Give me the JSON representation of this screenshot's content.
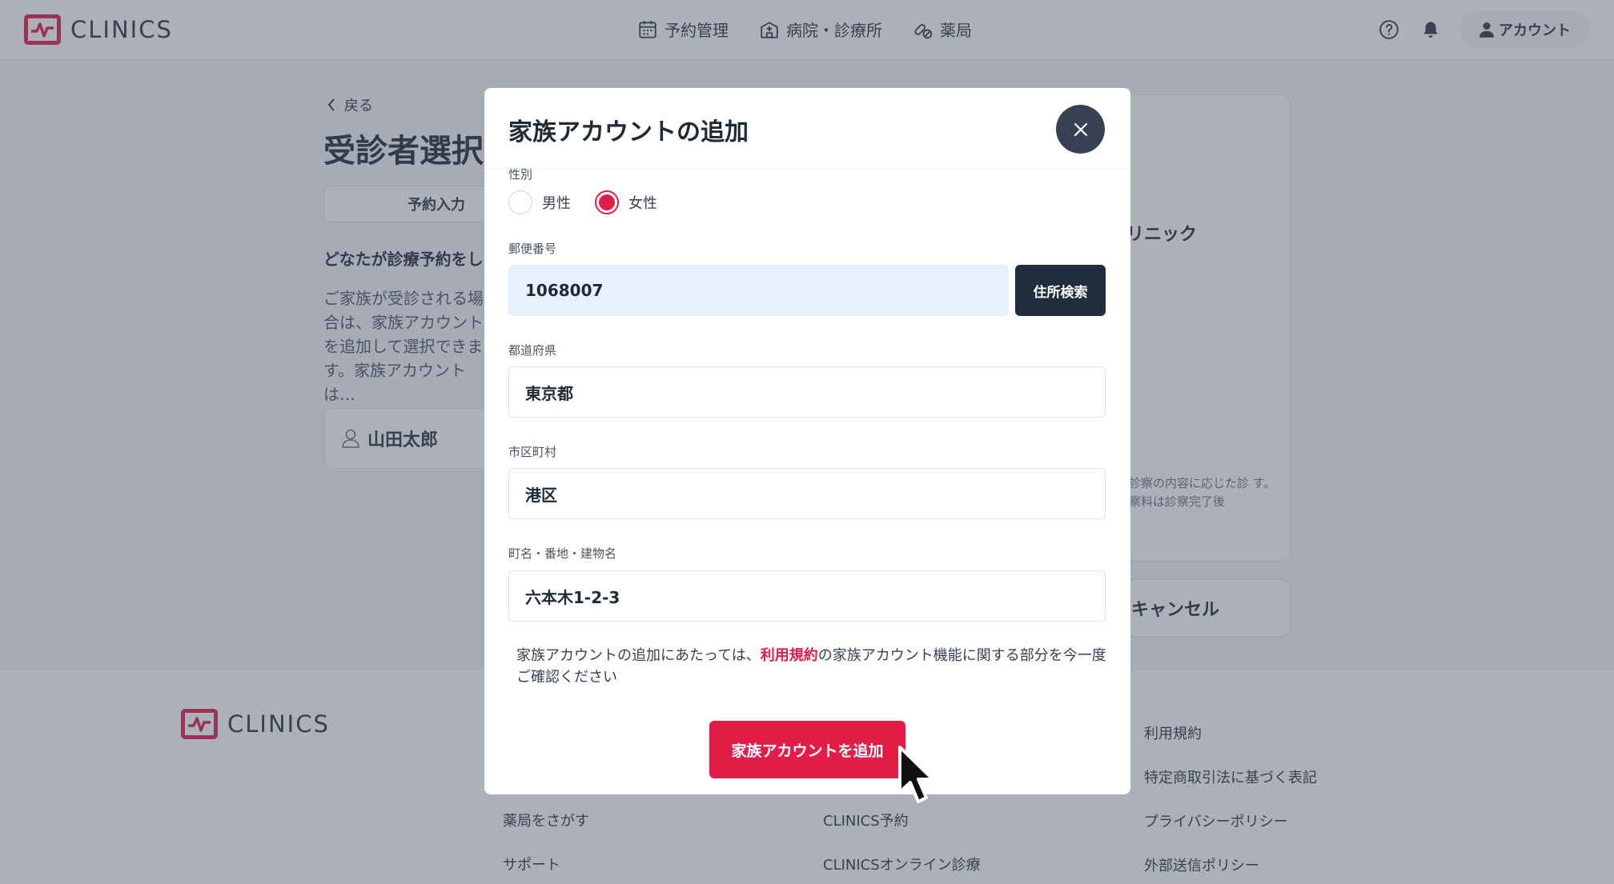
{
  "header": {
    "logo_text": "CLINICS",
    "nav": [
      {
        "label": "予約管理",
        "icon": "calendar-icon"
      },
      {
        "label": "病院・診療所",
        "icon": "hospital-icon"
      },
      {
        "label": "薬局",
        "icon": "pills-icon"
      }
    ],
    "account_label": "アカウント"
  },
  "page": {
    "back_label": "戻る",
    "title": "受診者選択",
    "tab_label": "予約入力",
    "question": "どなたが診療予約をし",
    "description": "ご家族が受診される場合は、家族アカウントを追加して選択できます。家族アカウントは…",
    "patient_name": "山田太郎",
    "side_clinic": "リニック",
    "side_note": "に診察の内容に応じた診 す。診察料は診察完了後",
    "cancel_label": "キャンセル"
  },
  "footer": {
    "logo_text": "CLINICS",
    "links": {
      "find_pharmacy": "薬局をさがす",
      "support": "サポート",
      "clinics_reserve": "CLINICS予約",
      "clinics_online": "CLINICSオンライン診療",
      "terms": "利用規約",
      "commerce": "特定商取引法に基づく表記",
      "privacy": "プライバシーポリシー",
      "external": "外部送信ポリシー"
    }
  },
  "modal": {
    "title": "家族アカウントの追加",
    "gender_label": "性別",
    "gender_options": [
      {
        "label": "男性",
        "checked": false
      },
      {
        "label": "女性",
        "checked": true
      }
    ],
    "postal_label": "郵便番号",
    "postal_value": "1068007",
    "address_search_label": "住所検索",
    "prefecture_label": "都道府県",
    "prefecture_value": "東京都",
    "city_label": "市区町村",
    "city_value": "港区",
    "street_label": "町名・番地・建物名",
    "street_value": "六本木1-2-3",
    "terms_before": "家族アカウントの追加にあたっては、",
    "terms_link": "利用規約",
    "terms_after": "の家族アカウント機能に関する部分を今一度ご確認ください",
    "submit_label": "家族アカウントを追加"
  },
  "colors": {
    "accent": "#e11d48",
    "dark_button": "#1f2d3d",
    "overlay": "rgba(70,82,100,0.45)",
    "filled_input": "#e7f0fd"
  }
}
